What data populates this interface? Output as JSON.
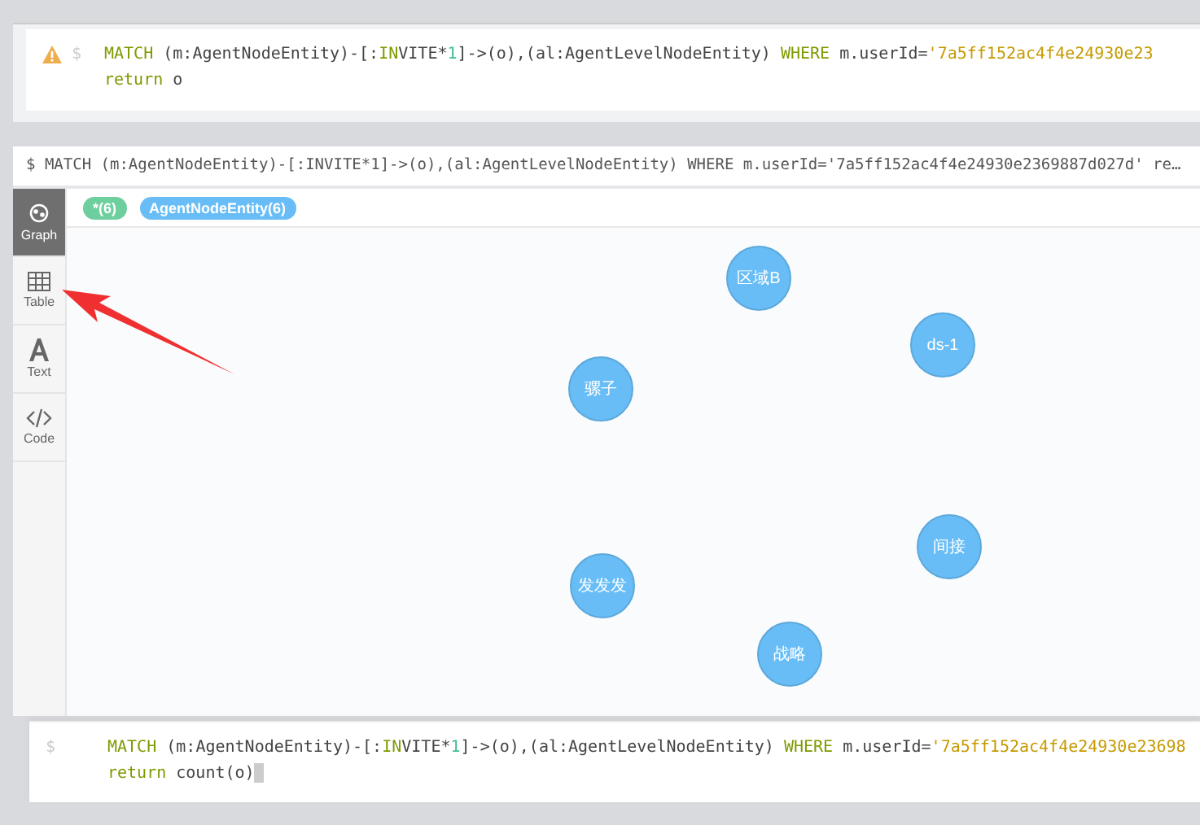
{
  "top_editor": {
    "warning": true,
    "prompt": "$",
    "lines": [
      [
        {
          "text": "MATCH",
          "kind": "keyword"
        },
        {
          "text": " (m:AgentNodeEntity)-[:",
          "kind": "plain"
        },
        {
          "text": "IN",
          "kind": "keyword"
        },
        {
          "text": "VITE*",
          "kind": "plain"
        },
        {
          "text": "1",
          "kind": "number"
        },
        {
          "text": "]->(o),(al:AgentLevelNodeEntity) ",
          "kind": "plain"
        },
        {
          "text": "WHERE",
          "kind": "keyword"
        },
        {
          "text": " m.userId=",
          "kind": "plain"
        },
        {
          "text": "'7a5ff152ac4f4e24930e23",
          "kind": "string"
        }
      ],
      [
        {
          "text": "return",
          "kind": "keyword"
        },
        {
          "text": " o",
          "kind": "plain"
        }
      ]
    ]
  },
  "result": {
    "query": "$ MATCH (m:AgentNodeEntity)-[:INVITE*1]->(o),(al:AgentLevelNodeEntity) WHERE m.userId='7a5ff152ac4f4e24930e2369887d027d' re…",
    "views": [
      {
        "label": "Graph",
        "kind": "graph",
        "selected": true
      },
      {
        "label": "Table",
        "kind": "table",
        "selected": false
      },
      {
        "label": "Text",
        "kind": "text",
        "selected": false
      },
      {
        "label": "Code",
        "kind": "code",
        "selected": false
      }
    ],
    "legend": [
      {
        "label": "*(6)",
        "color": "#6dce9e"
      },
      {
        "label": "AgentNodeEntity(6)",
        "color": "#68bdf6"
      }
    ],
    "nodes": [
      {
        "label": "区域B"
      },
      {
        "label": "ds-1"
      },
      {
        "label": "骡子"
      },
      {
        "label": "间接"
      },
      {
        "label": "发发发"
      },
      {
        "label": "战略"
      }
    ]
  },
  "bottom_editor": {
    "prompt": "$",
    "lines": [
      [
        {
          "text": "MATCH",
          "kind": "keyword"
        },
        {
          "text": " (m:AgentNodeEntity)-[:",
          "kind": "plain"
        },
        {
          "text": "IN",
          "kind": "keyword"
        },
        {
          "text": "VITE*",
          "kind": "plain"
        },
        {
          "text": "1",
          "kind": "number"
        },
        {
          "text": "]->(o),(al:AgentLevelNodeEntity) ",
          "kind": "plain"
        },
        {
          "text": "WHERE",
          "kind": "keyword"
        },
        {
          "text": " m.userId=",
          "kind": "plain"
        },
        {
          "text": "'7a5ff152ac4f4e24930e23698",
          "kind": "string"
        }
      ],
      [
        {
          "text": "return",
          "kind": "keyword"
        },
        {
          "text": " count(o)",
          "kind": "plain"
        }
      ]
    ]
  }
}
